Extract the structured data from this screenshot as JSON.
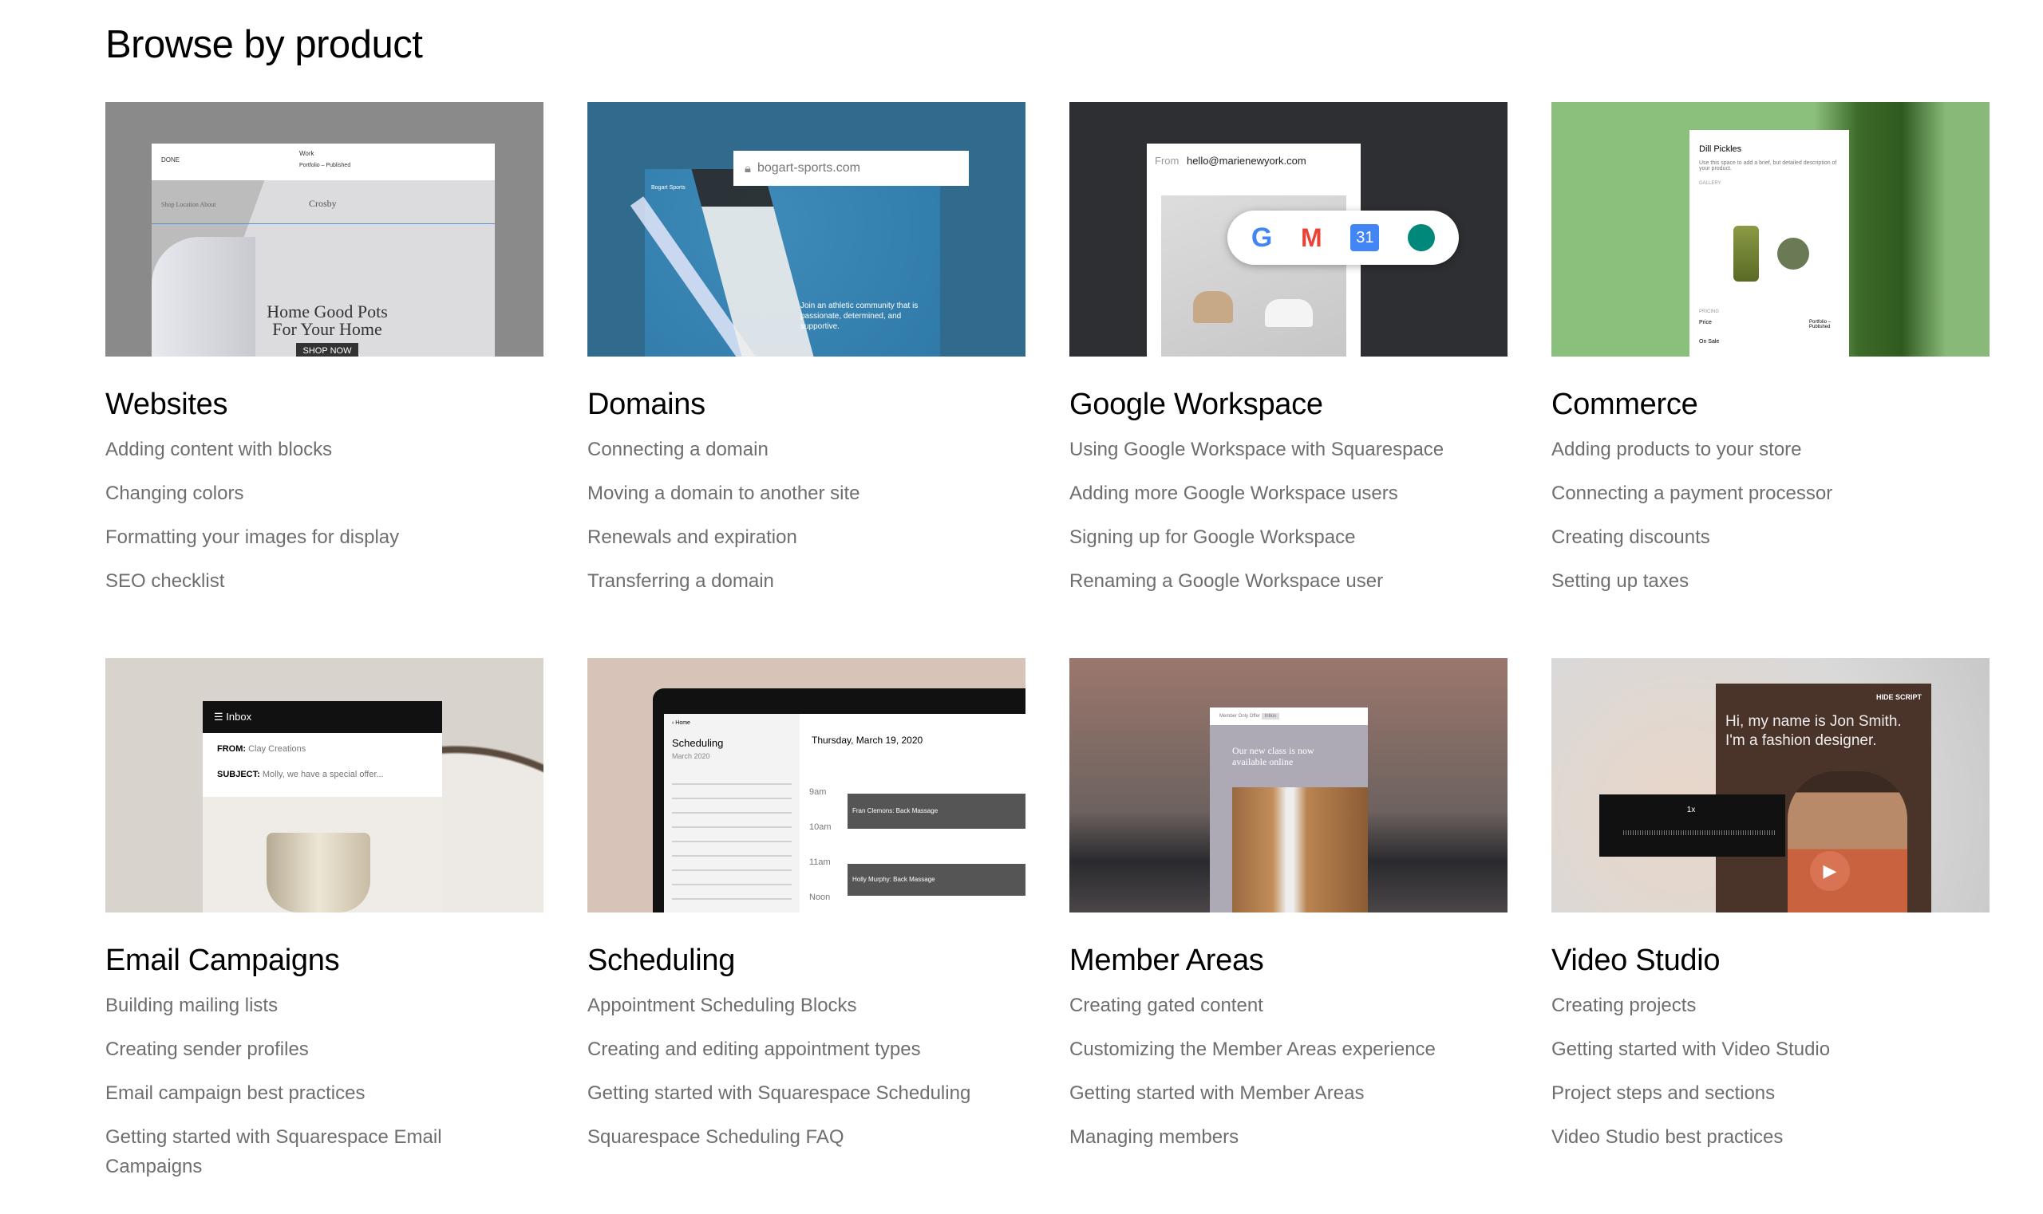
{
  "heading": "Browse by product",
  "products": [
    {
      "title": "Websites",
      "links": [
        "Adding content with blocks",
        "Changing colors",
        "Formatting your images for display",
        "SEO checklist"
      ],
      "mock": {
        "done": "DONE",
        "page": "Work",
        "status": "Portfolio – Published",
        "nav": "Shop  Location  About",
        "brand": "Crosby",
        "headline1": "Home Good Pots",
        "headline2": "For Your Home",
        "cta": "SHOP NOW"
      }
    },
    {
      "title": "Domains",
      "links": [
        "Connecting a domain",
        "Moving a domain to another site",
        "Renewals and expiration",
        "Transferring a domain"
      ],
      "mock": {
        "url": "bogart-sports.com",
        "brand": "Bogart Sports",
        "tagline": "Join an athletic community that is passionate, determined, and supportive."
      }
    },
    {
      "title": "Google Workspace",
      "links": [
        "Using Google Workspace with Squarespace",
        "Adding more Google Workspace users",
        "Signing up for Google Workspace",
        "Renaming a Google Workspace user"
      ],
      "mock": {
        "from_label": "From",
        "from": "hello@marienewyork.com",
        "calendar_day": "31"
      }
    },
    {
      "title": "Commerce",
      "links": [
        "Adding products to your store",
        "Connecting a payment processor",
        "Creating discounts",
        "Setting up taxes"
      ],
      "mock": {
        "product": "Dill Pickles",
        "desc": "Use this space to add a brief, but detailed description of your product.",
        "gallery": "GALLERY",
        "pricing": "PRICING",
        "price": "Price",
        "on_sale": "On Sale",
        "status": "Portfolio – Published"
      }
    },
    {
      "title": "Email Campaigns",
      "links": [
        "Building mailing lists",
        "Creating sender profiles",
        "Email campaign best practices",
        "Getting started with Squarespace Email Campaigns"
      ],
      "mock": {
        "inbox": "Inbox",
        "from_label": "FROM:",
        "from": "Clay Creations",
        "subject_label": "SUBJECT:",
        "subject": "Molly, we have a special offer..."
      }
    },
    {
      "title": "Scheduling",
      "links": [
        "Appointment Scheduling Blocks",
        "Creating and editing appointment types",
        "Getting started with Squarespace Scheduling",
        "Squarespace Scheduling FAQ"
      ],
      "mock": {
        "back": "‹ Home",
        "title": "Scheduling",
        "month": "March 2020",
        "date": "Thursday, March 19, 2020",
        "times": [
          "9am",
          "10am",
          "11am",
          "Noon"
        ],
        "appt1": "Fran Clemons: Back Massage",
        "appt2": "Holly Murphy: Back Massage"
      }
    },
    {
      "title": "Member Areas",
      "links": [
        "Creating gated content",
        "Customizing the Member Areas experience",
        "Getting started with Member Areas",
        "Managing members"
      ],
      "mock": {
        "subject": "Member Only Offer",
        "tag": "Inbox",
        "headline": "Our new class is now available online"
      }
    },
    {
      "title": "Video Studio",
      "links": [
        "Creating projects",
        "Getting started with Video Studio",
        "Project steps and sections",
        "Video Studio best practices"
      ],
      "mock": {
        "hide": "HIDE SCRIPT",
        "script": "Hi, my name is Jon Smith. I'm a fashion designer.",
        "speed": "1x"
      }
    }
  ]
}
